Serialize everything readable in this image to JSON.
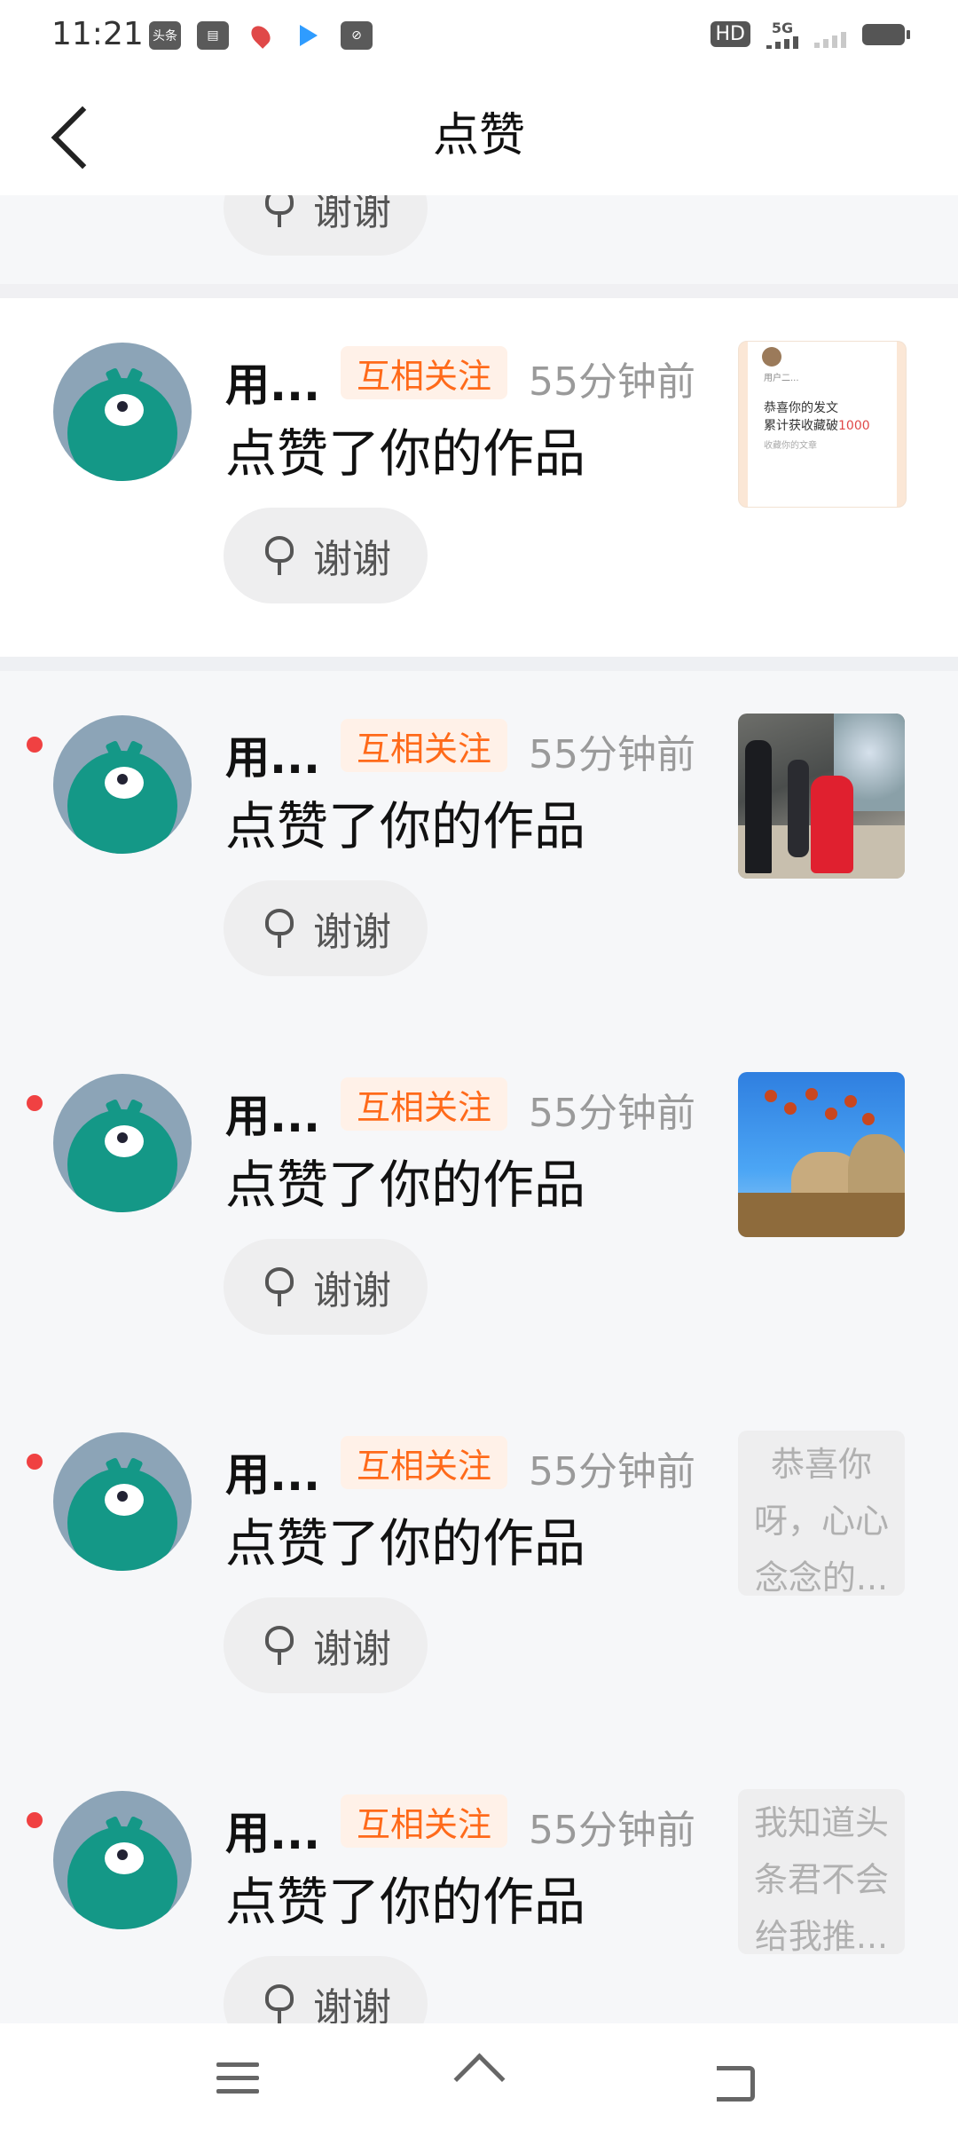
{
  "status_bar": {
    "time": "11:21",
    "app_icons": [
      "toutiao-icon",
      "calendar-icon",
      "map-pin-icon",
      "video-play-icon",
      "capsule-icon"
    ],
    "hd_label": "HD",
    "network_label": "5G"
  },
  "header": {
    "title": "点赞",
    "back_icon": "chevron-left-icon"
  },
  "partial_item": {
    "thanks_label": "谢谢"
  },
  "notifications": [
    {
      "user": "用...",
      "tag": "互相关注",
      "time": "55分钟前",
      "action": "点赞了你的作品",
      "thanks_label": "谢谢",
      "unread": false,
      "thumb": {
        "kind": "certificate",
        "user": "用户二...",
        "line1": "恭喜你的发文",
        "line2_prefix": "累计获收藏破",
        "line2_num": "1000",
        "line3": "收藏你的文章"
      }
    },
    {
      "user": "用...",
      "tag": "互相关注",
      "time": "55分钟前",
      "action": "点赞了你的作品",
      "thanks_label": "谢谢",
      "unread": true,
      "thumb": {
        "kind": "photo",
        "image": "family-photo"
      }
    },
    {
      "user": "用...",
      "tag": "互相关注",
      "time": "55分钟前",
      "action": "点赞了你的作品",
      "thanks_label": "谢谢",
      "unread": true,
      "thumb": {
        "kind": "photo",
        "image": "persimmon-mountain-photo"
      }
    },
    {
      "user": "用...",
      "tag": "互相关注",
      "time": "55分钟前",
      "action": "点赞了你的作品",
      "thanks_label": "谢谢",
      "unread": true,
      "thumb": {
        "kind": "text",
        "text": "恭喜你呀，心心念念的..."
      }
    },
    {
      "user": "用...",
      "tag": "互相关注",
      "time": "55分钟前",
      "action": "点赞了你的作品",
      "thanks_label": "谢谢",
      "unread": true,
      "thumb": {
        "kind": "text",
        "text": "我知道头条君不会给我推..."
      }
    }
  ],
  "nav_bar": {
    "icons": [
      "menu-icon",
      "home-icon",
      "back-icon"
    ]
  }
}
